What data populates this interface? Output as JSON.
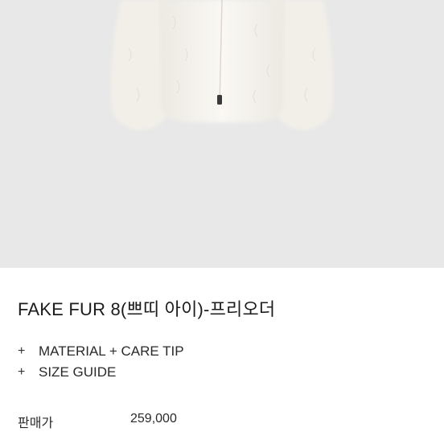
{
  "product": {
    "title": "FAKE FUR 8(쁘띠 아이)-프리오더",
    "image_alt": "white faux fur zip jacket"
  },
  "accordion": {
    "items": [
      {
        "icon": "+",
        "label": "MATERIAL + CARE TIP"
      },
      {
        "icon": "+",
        "label": "SIZE GUIDE"
      }
    ]
  },
  "price": {
    "label": "판매가",
    "value": "259,000"
  },
  "colors": {
    "hero_background": "#e8e8e8",
    "jacket": "#f6f4ef"
  }
}
